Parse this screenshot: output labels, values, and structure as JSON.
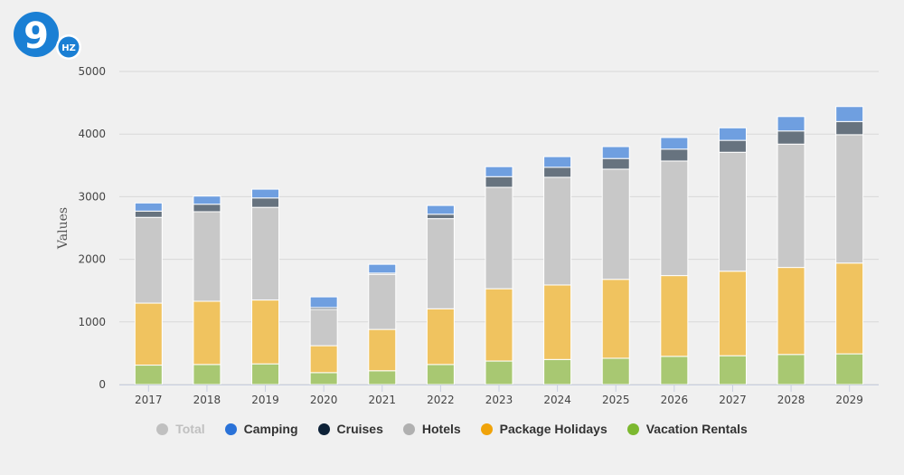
{
  "logo": {
    "text": "9",
    "badge": "HZ",
    "color": "#1a7fd4"
  },
  "chart_data": {
    "type": "bar",
    "stacked": true,
    "title": "",
    "xlabel": "",
    "ylabel": "Values",
    "ylim": [
      0,
      5000
    ],
    "yticks": [
      0,
      1000,
      2000,
      3000,
      4000,
      5000
    ],
    "grid": true,
    "legend_position": "bottom",
    "categories": [
      "2017",
      "2018",
      "2019",
      "2020",
      "2021",
      "2022",
      "2023",
      "2024",
      "2025",
      "2026",
      "2027",
      "2028",
      "2029"
    ],
    "series": [
      {
        "name": "Vacation Rentals",
        "color": "#a8c872",
        "legend_color": "#7cb82f",
        "values": [
          310,
          320,
          330,
          190,
          220,
          320,
          375,
          400,
          420,
          450,
          460,
          480,
          490
        ]
      },
      {
        "name": "Package Holidays",
        "color": "#f0c35f",
        "legend_color": "#f0a30a",
        "values": [
          990,
          1010,
          1020,
          430,
          660,
          890,
          1155,
          1190,
          1260,
          1290,
          1350,
          1390,
          1450
        ]
      },
      {
        "name": "Hotels",
        "color": "#c8c8c8",
        "legend_color": "#b0b0b0",
        "values": [
          1370,
          1430,
          1480,
          580,
          880,
          1440,
          1620,
          1720,
          1760,
          1830,
          1900,
          1970,
          2050
        ]
      },
      {
        "name": "Cruises",
        "color": "#67737f",
        "legend_color": "#0d2137",
        "values": [
          100,
          120,
          150,
          30,
          20,
          70,
          170,
          160,
          170,
          190,
          190,
          210,
          210
        ]
      },
      {
        "name": "Camping",
        "color": "#6f9fe0",
        "legend_color": "#2a72d8",
        "values": [
          130,
          130,
          140,
          170,
          140,
          140,
          160,
          170,
          190,
          185,
          200,
          230,
          240
        ]
      }
    ]
  },
  "legend": [
    {
      "label": "Total",
      "color": "#c0c0c0",
      "disabled": true
    },
    {
      "label": "Camping",
      "color": "#2a72d8",
      "disabled": false
    },
    {
      "label": "Cruises",
      "color": "#0d2137",
      "disabled": false
    },
    {
      "label": "Hotels",
      "color": "#b0b0b0",
      "disabled": false
    },
    {
      "label": "Package Holidays",
      "color": "#f0a30a",
      "disabled": false
    },
    {
      "label": "Vacation Rentals",
      "color": "#7cb82f",
      "disabled": false
    }
  ]
}
